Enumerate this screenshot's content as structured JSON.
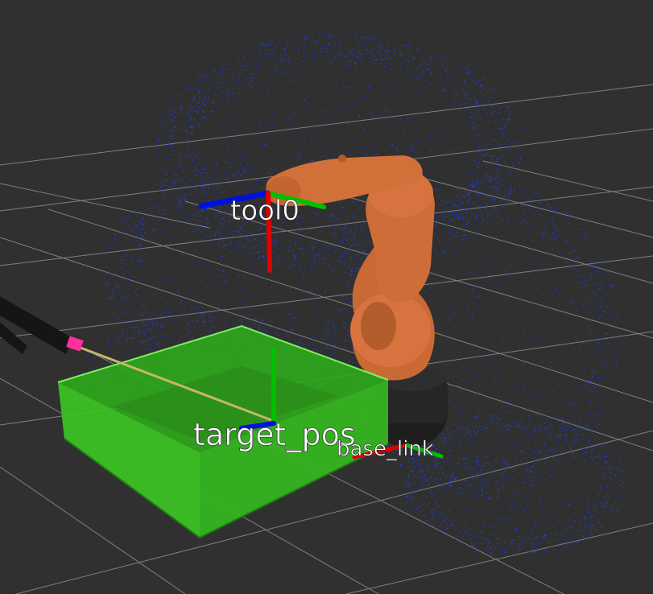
{
  "view": {
    "background_color": "#303030",
    "grid_color": "#9a9a9a"
  },
  "frames": {
    "tool0": {
      "label": "tool0"
    },
    "target_pos": {
      "label": "target_pos"
    },
    "base_link": {
      "label": "base_link"
    }
  },
  "colors": {
    "axis_x": "#e00000",
    "axis_y": "#00c000",
    "axis_z": "#0010e0",
    "robot": "#d8733f",
    "robot_base": "#222222",
    "bin": "#3fcf2a",
    "pointcloud": "#1a40ff",
    "ray": "#c8b56a",
    "gripper": "#151515",
    "gripper_tip": "#ff2fa0"
  }
}
